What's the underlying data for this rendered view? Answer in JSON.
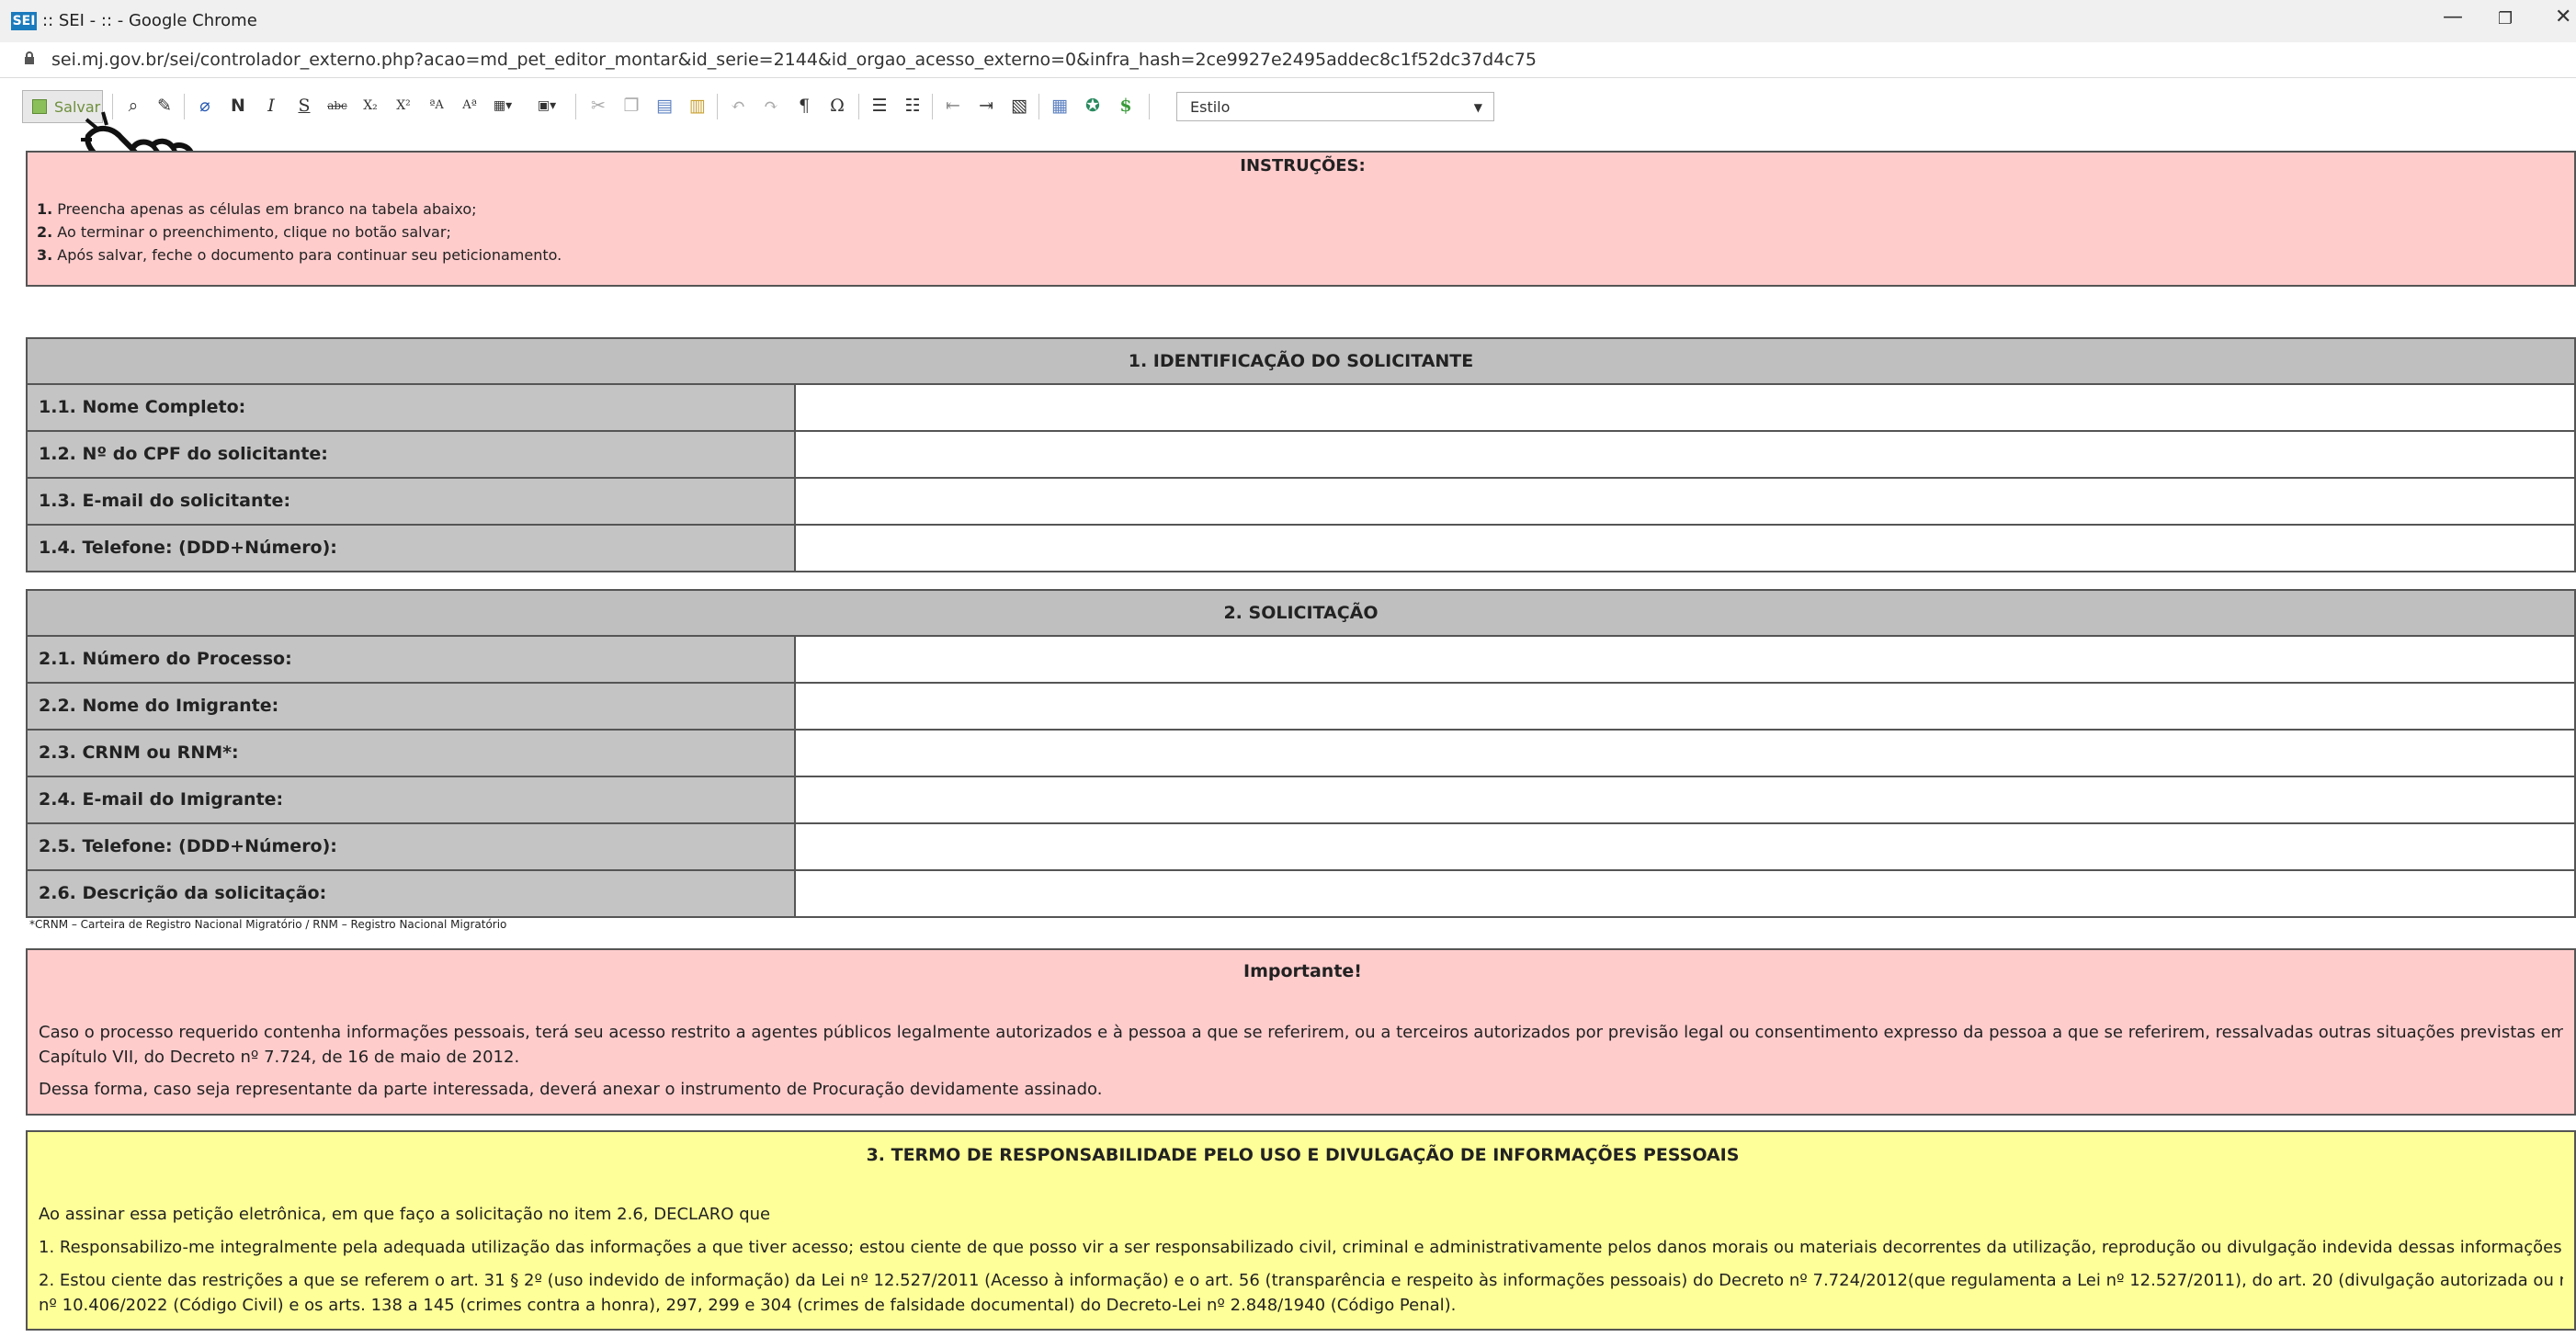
{
  "browser": {
    "favicon_text": "SEI",
    "title": ":: SEI - :: - Google Chrome",
    "url": "sei.mj.gov.br/sei/controlador_externo.php?acao=md_pet_editor_montar&id_serie=2144&id_orgao_acesso_externo=0&infra_hash=2ce9927e2495addec8c1f52dc37d4c75",
    "minimize": "—",
    "restore": "❐",
    "close": "✕"
  },
  "toolbar": {
    "save_label": "Salvar",
    "bold": "N",
    "italic": "I",
    "underline": "S",
    "strike": "abc",
    "subscript": "X₂",
    "superscript": "X²",
    "omega": "Ω",
    "pilcrow": "¶",
    "style_select": "Estilo"
  },
  "instructions": {
    "title": "INSTRUÇÕES:",
    "lines": [
      {
        "num": "1.",
        "text": " Preencha apenas as células em branco na tabela abaixo;"
      },
      {
        "num": "2.",
        "text": " Ao terminar o preenchimento, clique no botão salvar;"
      },
      {
        "num": "3.",
        "text": " Após salvar, feche o documento para continuar seu peticionamento."
      }
    ]
  },
  "section1": {
    "title": "1. IDENTIFICAÇÃO DO SOLICITANTE",
    "rows": [
      {
        "label": "1.1. Nome Completo:"
      },
      {
        "label": "1.2. Nº do CPF do solicitante:"
      },
      {
        "label": "1.3. E-mail do solicitante:"
      },
      {
        "label": "1.4. Telefone: (DDD+Número):"
      }
    ]
  },
  "section2": {
    "title": "2. SOLICITAÇÃO",
    "rows": [
      {
        "label": "2.1. Número do Processo:"
      },
      {
        "label": "2.2. Nome do Imigrante:"
      },
      {
        "label": "2.3. CRNM ou RNM*:"
      },
      {
        "label": "2.4. E-mail do Imigrante:"
      },
      {
        "label": "2.5. Telefone: (DDD+Número):"
      },
      {
        "label": "2.6. Descrição da solicitação:"
      }
    ],
    "footnote": "*CRNM – Carteira de Registro Nacional Migratório / RNM – Registro Nacional Migratório"
  },
  "important": {
    "title": "Importante!",
    "p1_line1": "Caso o processo requerido contenha informações pessoais, terá seu acesso restrito a agentes públicos legalmente autorizados e à pessoa a que se referirem, ou a terceiros autorizados por previsão legal ou consentimento expresso da pessoa a que se referirem, ressalvadas outras situações previstas em Lei, nos termos do",
    "p1_line2": "Capítulo VII, do Decreto nº 7.724, de 16 de maio de 2012.",
    "p2": "Dessa forma, caso seja representante da parte interessada, deverá anexar o instrumento de Procuração devidamente assinado."
  },
  "termo": {
    "title": "3. TERMO DE RESPONSABILIDADE PELO USO E DIVULGAÇÃO DE INFORMAÇÕES PESSOAIS",
    "intro": "Ao assinar essa petição eletrônica, em que faço a solicitação no item 2.6, DECLARO que",
    "item1": "1. Responsabilizo-me integralmente pela adequada utilização das informações a que tiver acesso; estou ciente de que posso vir a ser responsabilizado civil, criminal e administrativamente pelos danos morais ou materiais decorrentes da utilização, reprodução ou divulgação indevida dessas informações; e que",
    "item2_line1": "2. Estou ciente das restrições a que se referem o art. 31 § 2º (uso indevido de informação) da Lei nº 12.527/2011 (Acesso à informação) e o art. 56 (transparência e respeito às informações pessoais) do Decreto nº 7.724/2012(que regulamenta a Lei nº 12.527/2011), do art. 20 (divulgação autorizada ou necessária) da Lei",
    "item2_line2": "nº 10.406/2022 (Código Civil) e os arts. 138 a 145 (crimes contra a honra), 297, 299 e 304 (crimes de falsidade documental) do Decreto-Lei nº 2.848/1940 (Código Penal)."
  }
}
